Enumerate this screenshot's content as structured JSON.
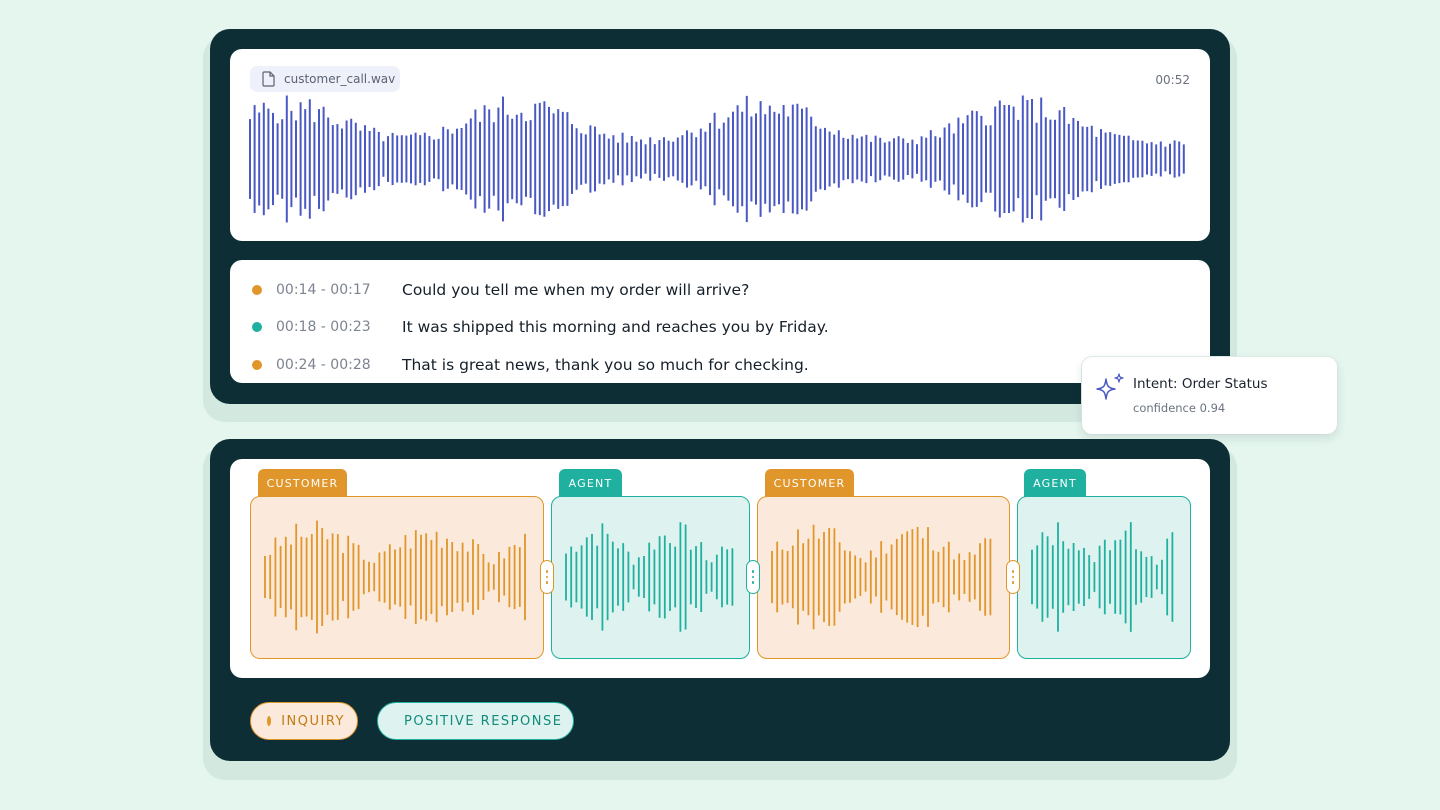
{
  "file": {
    "name": "customer_call.wav",
    "duration": "00:52",
    "icon": "file-icon"
  },
  "transcript": [
    {
      "speaker": "customer",
      "time": "00:14 - 00:17",
      "text": "Could you tell me when my order will arrive?"
    },
    {
      "speaker": "agent",
      "time": "00:18 - 00:23",
      "text": "It was shipped this morning and reaches you by Friday."
    },
    {
      "speaker": "customer",
      "time": "00:24 - 00:28",
      "text": "That is great news, thank you so much for checking."
    }
  ],
  "intent": {
    "title": "Intent: Order Status",
    "confidence": "confidence 0.94",
    "icon": "sparkle-icon"
  },
  "segments": [
    {
      "speaker": "customer",
      "label": "CUSTOMER"
    },
    {
      "speaker": "agent",
      "label": "AGENT"
    },
    {
      "speaker": "customer",
      "label": "CUSTOMER"
    },
    {
      "speaker": "agent",
      "label": "AGENT"
    }
  ],
  "sentiments": [
    {
      "speaker": "customer",
      "label": "INQUIRY"
    },
    {
      "speaker": "agent",
      "label": "POSITIVE RESPONSE"
    }
  ],
  "colors": {
    "background": "#e4f6ee",
    "card": "#0d2e34",
    "waveform": "#4a58c4",
    "customer": "#e0962a",
    "customer_fill": "#fbeadb",
    "agent": "#1fb09f",
    "agent_fill": "#def3ef"
  }
}
